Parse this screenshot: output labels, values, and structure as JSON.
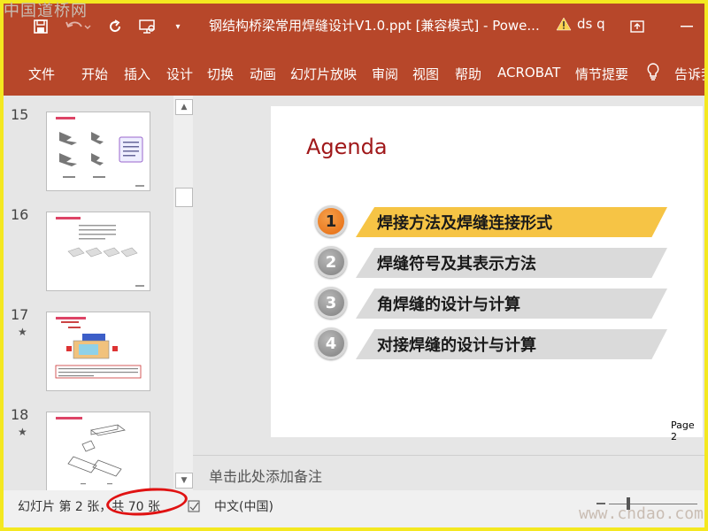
{
  "watermarks": {
    "top": "中国道桥网",
    "bottom": "www.cndao.com"
  },
  "titlebar": {
    "title": "钢结构桥梁常用焊缝设计V1.0.ppt [兼容模式] - Powe...",
    "account": "ds q",
    "icons": [
      "save-icon",
      "undo-icon",
      "redo-icon",
      "present-icon",
      "customize-qat-icon",
      "warning-icon",
      "restore-ribbon-icon",
      "minimize-icon"
    ]
  },
  "menu": {
    "items": [
      "文件",
      "开始",
      "插入",
      "设计",
      "切换",
      "动画",
      "幻灯片放映",
      "审阅",
      "视图",
      "帮助",
      "ACROBAT",
      "情节提要"
    ],
    "tell_me": "告诉我"
  },
  "thumbnails": [
    {
      "number": "15",
      "star": ""
    },
    {
      "number": "16",
      "star": ""
    },
    {
      "number": "17",
      "star": "★"
    },
    {
      "number": "18",
      "star": "★"
    }
  ],
  "slide": {
    "title": "Agenda",
    "items": [
      {
        "num": "1",
        "text": "焊接方法及焊缝连接形式",
        "active": true
      },
      {
        "num": "2",
        "text": "焊缝符号及其表示方法",
        "active": false
      },
      {
        "num": "3",
        "text": "角焊缝的设计与计算",
        "active": false
      },
      {
        "num": "4",
        "text": "对接焊缝的设计与计算",
        "active": false
      }
    ],
    "page_label": "Page 2"
  },
  "notes": {
    "placeholder": "单击此处添加备注"
  },
  "status": {
    "slide_info": "幻灯片 第 2 张，共 70 张",
    "language": "中文(中国)"
  },
  "colors": {
    "ribbon": "#b7472a",
    "title_red": "#a0181a",
    "active_bar": "#f6c445",
    "inactive_bar": "#dadada",
    "annotation_oval": "#e01212"
  }
}
